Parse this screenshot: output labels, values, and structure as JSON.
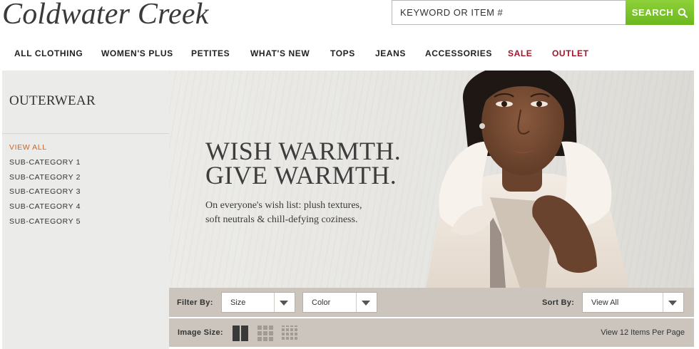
{
  "brand": {
    "logo_text": "Coldwater Creek"
  },
  "search": {
    "placeholder": "KEYWORD OR ITEM #",
    "button_label": "SEARCH",
    "icon": "search-icon"
  },
  "nav": {
    "items": [
      {
        "label": "ALL CLOTHING"
      },
      {
        "label": "WOMEN'S PLUS"
      },
      {
        "label": "PETITES"
      },
      {
        "label": "WHAT'S NEW"
      },
      {
        "label": "TOPS"
      },
      {
        "label": "JEANS"
      },
      {
        "label": "ACCESSORIES"
      },
      {
        "label": "SALE"
      },
      {
        "label": "OUTLET"
      }
    ],
    "highlight_color": "#a1142b"
  },
  "sidebar": {
    "title": "OUTERWEAR",
    "links": [
      {
        "label": "VIEW ALL"
      },
      {
        "label": "SUB-CATEGORY 1"
      },
      {
        "label": "SUB-CATEGORY 2"
      },
      {
        "label": "SUB-CATEGORY 3"
      },
      {
        "label": "SUB-CATEGORY 4"
      },
      {
        "label": "SUB-CATEGORY 5"
      }
    ],
    "active_color": "#d8601a"
  },
  "hero": {
    "headline_line1": "WISH WARMTH.",
    "headline_line2": "GIVE WARMTH.",
    "sub_line1": "On everyone's wish list: plush textures,",
    "sub_line2": "soft neutrals & chill-defying coziness."
  },
  "filters": {
    "filter_label": "Filter By:",
    "size_value": "Size",
    "color_value": "Color",
    "sort_label": "Sort By:",
    "sort_value": "View All"
  },
  "image_size": {
    "label": "Image Size:",
    "options": [
      "large-grid-icon",
      "medium-grid-icon",
      "small-grid-icon"
    ],
    "per_page_text": "View 12 Items Per Page"
  },
  "colors": {
    "accent_green": "#7cc42a",
    "toolbar_bg": "#cbc5be",
    "sidebar_bg": "#ebebe9"
  }
}
